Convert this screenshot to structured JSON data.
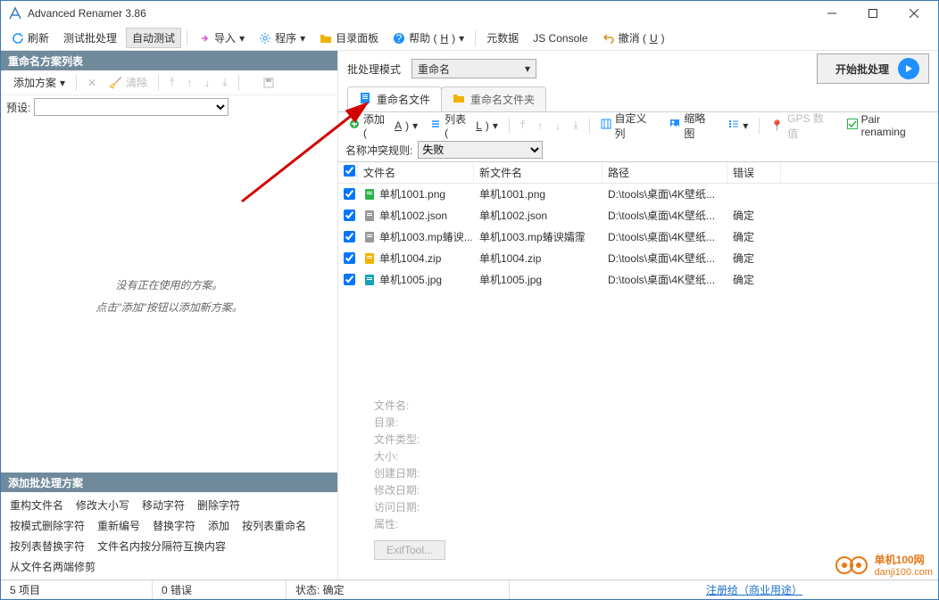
{
  "title": "Advanced Renamer 3.86",
  "menu": {
    "refresh": "刷新",
    "testbatch": "测试批处理",
    "autotest": "自动测试",
    "import": "导入",
    "program": "程序",
    "dirpanel": "目录面板",
    "help": "帮助 (",
    "help_u": "H",
    "help_end": ")",
    "meta": "元数据",
    "jsconsole": "JS Console",
    "undo": "撤消 (",
    "undo_u": "U",
    "undo_end": ")"
  },
  "left": {
    "header": "重命名方案列表",
    "addmethod": "添加方案",
    "clear": "清除",
    "preset_label": "预设:",
    "empty1": "没有正在使用的方案。",
    "empty2": "点击\"添加\"按钮以添加新方案。"
  },
  "addpanel": {
    "header": "添加批处理方案",
    "items": [
      [
        "重构文件名",
        "修改大小写",
        "移动字符",
        "删除字符"
      ],
      [
        "按模式删除字符",
        "重新编号",
        "替换字符",
        "添加",
        "按列表重命名"
      ],
      [
        "按列表替换字符",
        "文件名内按分隔符互换内容"
      ],
      [
        "从文件名两端修剪"
      ]
    ]
  },
  "right": {
    "mode_label": "批处理模式",
    "mode_value": "重命名",
    "start": "开始批处理",
    "tab_files": "重命名文件",
    "tab_folders": "重命名文件夹",
    "add": "添加 (",
    "add_u": "A",
    "add_end": ")",
    "list": "列表 (",
    "list_u": "L",
    "list_end": ")",
    "customcol": "自定义列",
    "thumb": "缩略图",
    "gps": "GPS 数值",
    "pair": "Pair renaming",
    "rule_label": "名称冲突规则:",
    "rule_value": "失败",
    "cols": {
      "name": "文件名",
      "newname": "新文件名",
      "path": "路径",
      "err": "错误"
    },
    "rows": [
      {
        "name": "单机1001.png",
        "new": "单机1001.png",
        "path": "D:\\tools\\桌面\\4K壁纸...",
        "err": "",
        "ico": "png",
        "color": "#2bb24c"
      },
      {
        "name": "单机1002.json",
        "new": "单机1002.json",
        "path": "D:\\tools\\桌面\\4K壁纸...",
        "err": "确定",
        "ico": "file",
        "color": "#999"
      },
      {
        "name": "单机1003.mp蝽谀...",
        "new": "单机1003.mp蝽谀孀霪",
        "path": "D:\\tools\\桌面\\4K壁纸...",
        "err": "确定",
        "ico": "file",
        "color": "#999"
      },
      {
        "name": "单机1004.zip",
        "new": "单机1004.zip",
        "path": "D:\\tools\\桌面\\4K壁纸...",
        "err": "确定",
        "ico": "zip",
        "color": "#f0b400"
      },
      {
        "name": "单机1005.jpg",
        "new": "单机1005.jpg",
        "path": "D:\\tools\\桌面\\4K壁纸...",
        "err": "确定",
        "ico": "jpg",
        "color": "#17a2b8"
      }
    ],
    "details": [
      "文件名:",
      "目录:",
      "文件类型:",
      "大小:",
      "创建日期:",
      "修改日期:",
      "访问日期:",
      "属性:"
    ],
    "exif": "ExifTool..."
  },
  "status": {
    "items": "5 项目",
    "errors": "0 错误",
    "state": "状态: 确定",
    "reg": "注册给（商业用途）"
  },
  "watermark": {
    "name": "单机100网",
    "url": "danji100.com"
  }
}
